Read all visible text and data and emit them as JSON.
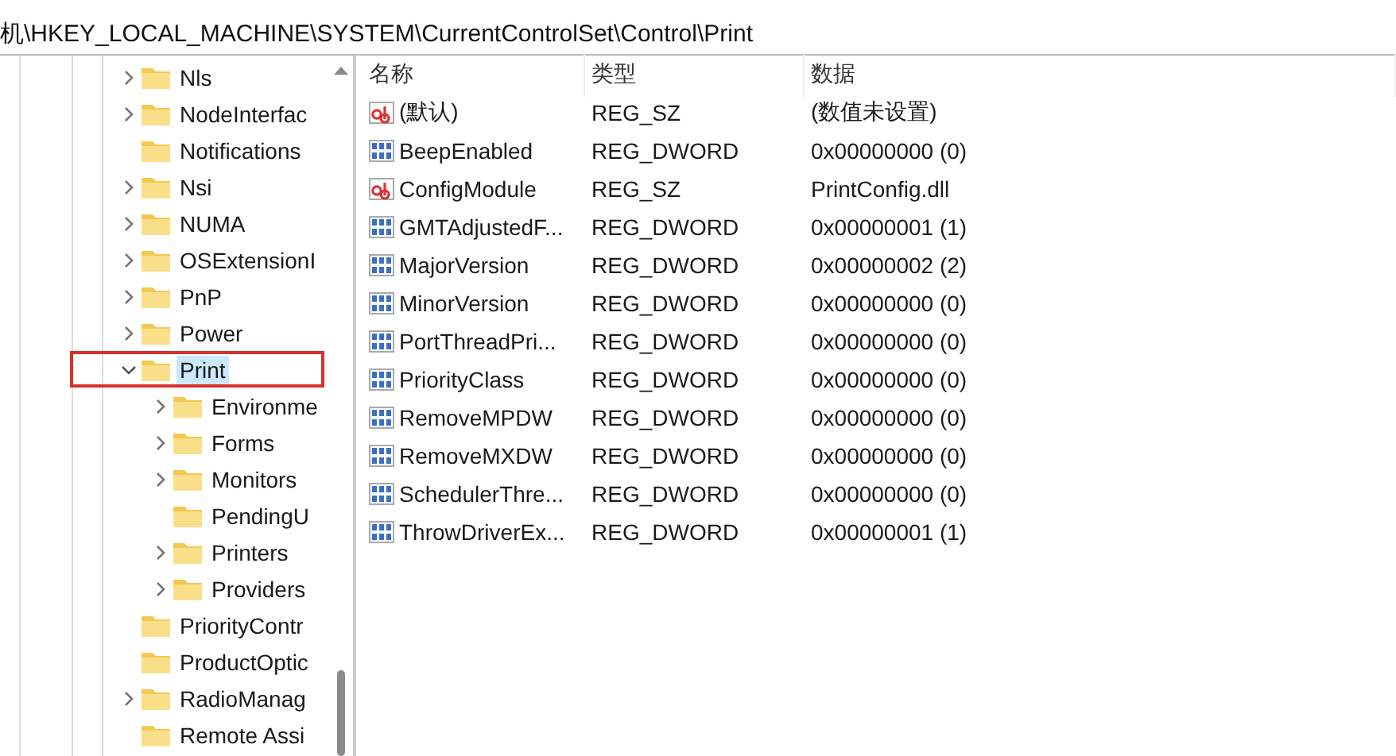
{
  "address_bar": {
    "path": "机\\HKEY_LOCAL_MACHINE\\SYSTEM\\CurrentControlSet\\Control\\Print"
  },
  "tree": {
    "items": [
      {
        "label": "Nls",
        "expanded": false,
        "selected": false,
        "highlighted": false
      },
      {
        "label": "NodeInterfac",
        "expanded": false,
        "selected": false,
        "highlighted": false
      },
      {
        "label": "Notifications",
        "selected": false,
        "highlighted": false
      },
      {
        "label": "Nsi",
        "expanded": false,
        "selected": false,
        "highlighted": false
      },
      {
        "label": "NUMA",
        "expanded": false,
        "selected": false,
        "highlighted": false
      },
      {
        "label": "OSExtensionI",
        "expanded": false,
        "selected": false,
        "highlighted": false
      },
      {
        "label": "PnP",
        "expanded": false,
        "selected": false,
        "highlighted": false
      },
      {
        "label": "Power",
        "expanded": false,
        "selected": false,
        "highlighted": false
      },
      {
        "label": "Print",
        "expanded": true,
        "selected": true,
        "highlighted": true,
        "children": [
          {
            "label": "Environme",
            "expanded": false,
            "selected": false,
            "highlighted": false
          },
          {
            "label": "Forms",
            "expanded": false,
            "selected": false,
            "highlighted": false
          },
          {
            "label": "Monitors",
            "expanded": false,
            "selected": false,
            "highlighted": false
          },
          {
            "label": "PendingU",
            "selected": false,
            "highlighted": false
          },
          {
            "label": "Printers",
            "expanded": false,
            "selected": false,
            "highlighted": false
          },
          {
            "label": "Providers",
            "expanded": false,
            "selected": false,
            "highlighted": false
          }
        ]
      },
      {
        "label": "PriorityContr",
        "selected": false,
        "highlighted": false
      },
      {
        "label": "ProductOptic",
        "selected": false,
        "highlighted": false
      },
      {
        "label": "RadioManag",
        "expanded": false,
        "selected": false,
        "highlighted": false
      },
      {
        "label": "Remote Assi",
        "selected": false,
        "highlighted": false
      }
    ]
  },
  "values": {
    "columns": [
      "名称",
      "类型",
      "数据"
    ],
    "rows": [
      {
        "kind": "string",
        "name": "(默认)",
        "type": "REG_SZ",
        "data": "(数值未设置)"
      },
      {
        "kind": "dword",
        "name": "BeepEnabled",
        "type": "REG_DWORD",
        "data": "0x00000000 (0)"
      },
      {
        "kind": "string",
        "name": "ConfigModule",
        "type": "REG_SZ",
        "data": "PrintConfig.dll"
      },
      {
        "kind": "dword",
        "name": "GMTAdjustedF...",
        "type": "REG_DWORD",
        "data": "0x00000001 (1)"
      },
      {
        "kind": "dword",
        "name": "MajorVersion",
        "type": "REG_DWORD",
        "data": "0x00000002 (2)"
      },
      {
        "kind": "dword",
        "name": "MinorVersion",
        "type": "REG_DWORD",
        "data": "0x00000000 (0)"
      },
      {
        "kind": "dword",
        "name": "PortThreadPri...",
        "type": "REG_DWORD",
        "data": "0x00000000 (0)"
      },
      {
        "kind": "dword",
        "name": "PriorityClass",
        "type": "REG_DWORD",
        "data": "0x00000000 (0)"
      },
      {
        "kind": "dword",
        "name": "RemoveMPDW",
        "type": "REG_DWORD",
        "data": "0x00000000 (0)"
      },
      {
        "kind": "dword",
        "name": "RemoveMXDW",
        "type": "REG_DWORD",
        "data": "0x00000000 (0)"
      },
      {
        "kind": "dword",
        "name": "SchedulerThre...",
        "type": "REG_DWORD",
        "data": "0x00000000 (0)"
      },
      {
        "kind": "dword",
        "name": "ThrowDriverEx...",
        "type": "REG_DWORD",
        "data": "0x00000001 (1)"
      }
    ]
  }
}
